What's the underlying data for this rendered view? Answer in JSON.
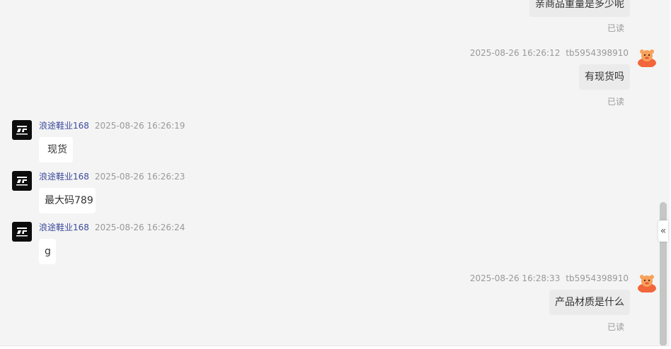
{
  "messages": [
    {
      "text": "亲商品重量是多少呢",
      "read": "已读"
    },
    {
      "timestamp": "2025-08-26 16:26:12",
      "user_id": "tb5954398910",
      "text": "有现货吗",
      "read": "已读"
    },
    {
      "sender": "浪途鞋业168",
      "timestamp": "2025-08-26 16:26:19",
      "text": "现货"
    },
    {
      "sender": "浪途鞋业168",
      "timestamp": "2025-08-26 16:26:23",
      "text": "最大码789"
    },
    {
      "sender": "浪途鞋业168",
      "timestamp": "2025-08-26 16:26:24",
      "text": "g"
    },
    {
      "timestamp": "2025-08-26 16:28:33",
      "user_id": "tb5954398910",
      "text": "产品材质是什么",
      "read": "已读"
    }
  ],
  "icons": {
    "shop_avatar": "shop-logo-icon",
    "buyer_avatar": "cartoon-avatar-icon",
    "collapse": "double-chevron-left-icon"
  },
  "colors": {
    "sender_name": "#3b4a9c",
    "incoming_bubble": "#ffffff",
    "outgoing_bubble": "#ebebeb",
    "pane_background": "#f4f4f4"
  },
  "scroll_position": 1.0
}
